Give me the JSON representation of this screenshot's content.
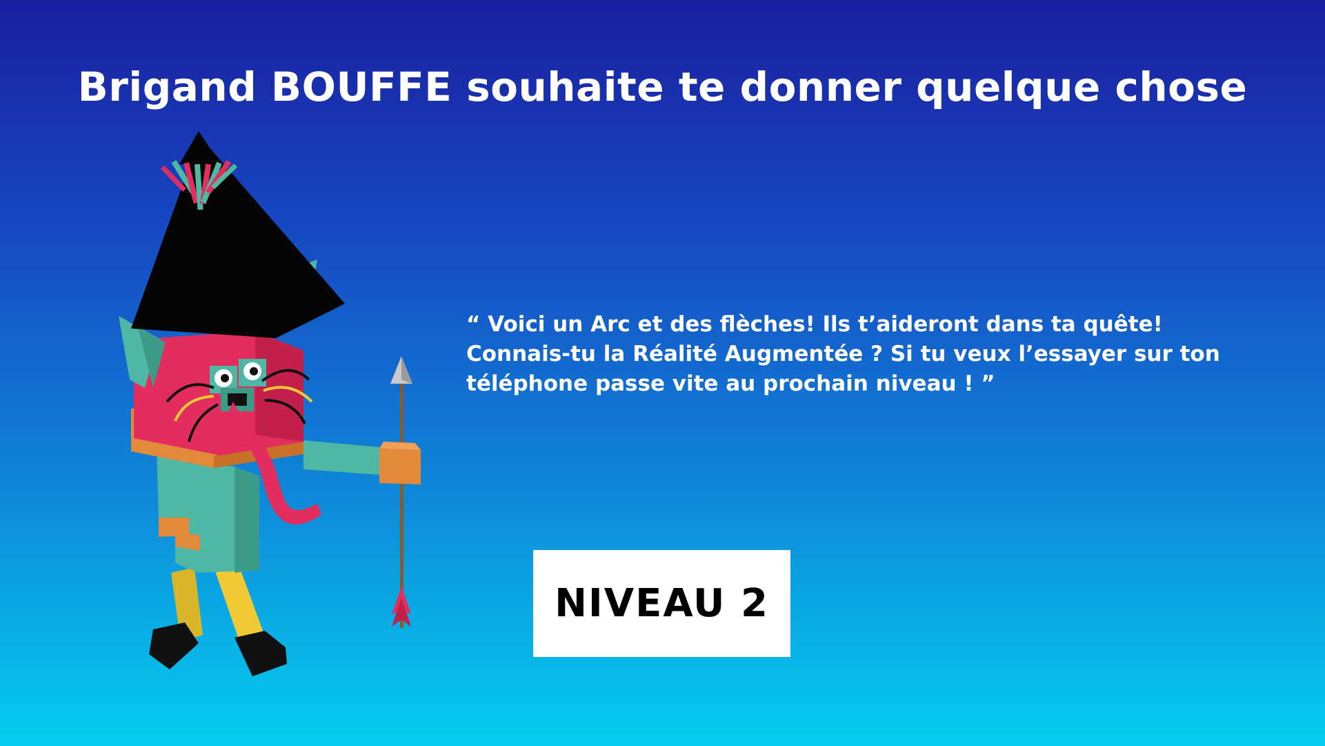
{
  "header": {
    "title": "Brigand BOUFFE souhaite te donner quelque chose"
  },
  "dialogue": {
    "lines": [
      "“ Voici un Arc et des flèches! Ils t’aideront dans ta quête!",
      "Connais-tu la Réalité Augmentée ? Si tu veux l’essayer sur ton",
      "téléphone passe vite au prochain niveau ! ”"
    ]
  },
  "actions": {
    "level_button_label": "NIVEAU 2"
  },
  "character": {
    "icon": "brigand-bouffe-character",
    "held_item_icon": "arrow-icon"
  },
  "colors": {
    "background_top": "#1a1f9e",
    "background_bottom": "#04cdf0",
    "button_bg": "#ffffff",
    "text": "#ffffff"
  }
}
